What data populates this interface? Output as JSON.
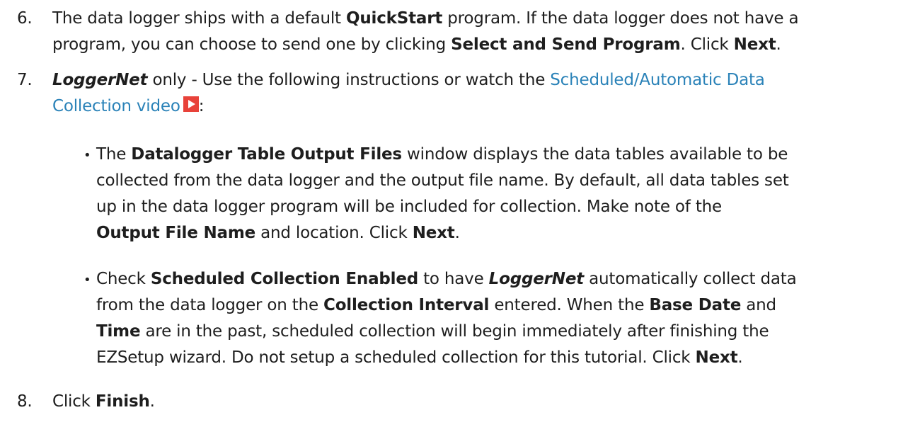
{
  "steps": [
    {
      "number": "6.",
      "line1": {
        "t1": "The data logger ships with a default ",
        "b1": "QuickStart",
        "t2": " program. If the data logger does not have a"
      },
      "line2": {
        "t1": "program, you can choose to send one by clicking ",
        "b1": "Select and Send Program",
        "t2": ". Click ",
        "b2": "Next",
        "t3": "."
      }
    },
    {
      "number": "7.",
      "line1": {
        "i1": "LoggerNet",
        "t1": " only - Use the following instructions or watch the ",
        "link1": "Scheduled/Automatic Data"
      },
      "line2": {
        "link2": "Collection video",
        "video_icon": "play-icon",
        "t1": ":"
      },
      "bullets": [
        {
          "lines": [
            {
              "t1": "The ",
              "b1": "Datalogger Table Output Files",
              "t2": " window displays the data tables available to be"
            },
            {
              "t1": "collected from the data logger and the output file name. By default, all data tables set"
            },
            {
              "t1": "up in the data logger program will be included for collection. Make note of the"
            },
            {
              "b1": "Output File Name",
              "t1": " and location. Click ",
              "b2": "Next",
              "t2": "."
            }
          ]
        },
        {
          "lines": [
            {
              "t1": "Check ",
              "b1": "Scheduled Collection Enabled",
              "t2": " to have ",
              "i1": "LoggerNet",
              "t3": " automatically collect data"
            },
            {
              "t1": "from the data logger on the ",
              "b1": "Collection Interval",
              "t2": " entered. When the ",
              "b2": "Base Date",
              "t3": " and"
            },
            {
              "b1": "Time",
              "t1": " are in the past, scheduled collection will begin immediately after finishing the"
            },
            {
              "t1": "EZSetup wizard. Do not setup a scheduled collection for this tutorial. Click ",
              "b1": "Next",
              "t2": "."
            }
          ]
        }
      ]
    },
    {
      "number": "8.",
      "line1": {
        "t1": "Click ",
        "b1": "Finish",
        "t2": "."
      }
    }
  ],
  "colors": {
    "text": "#1e1e1e",
    "link": "#2a82b8",
    "video_icon": "#e8423a"
  }
}
